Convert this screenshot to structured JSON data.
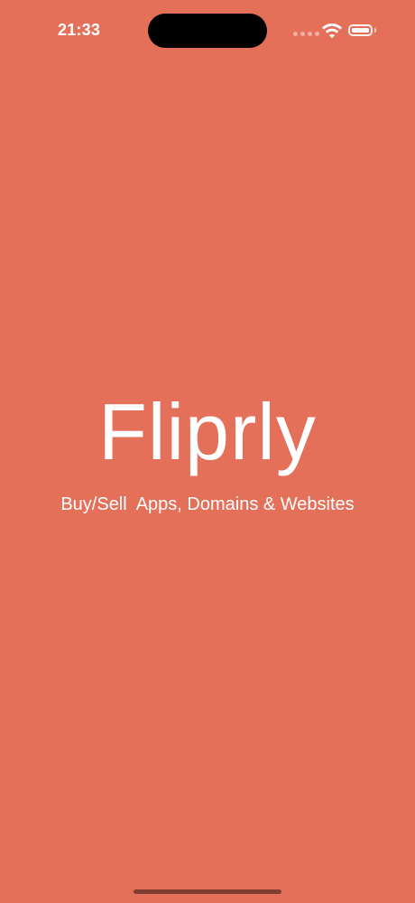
{
  "status_bar": {
    "time": "21:33",
    "icons": [
      "cellular-signal-icon",
      "wifi-icon",
      "battery-icon"
    ]
  },
  "splash": {
    "title": "Fliprly",
    "tagline": "Buy/Sell  Apps, Domains & Websites"
  },
  "colors": {
    "background": "#E5705A",
    "text": "#FFFFFF"
  }
}
